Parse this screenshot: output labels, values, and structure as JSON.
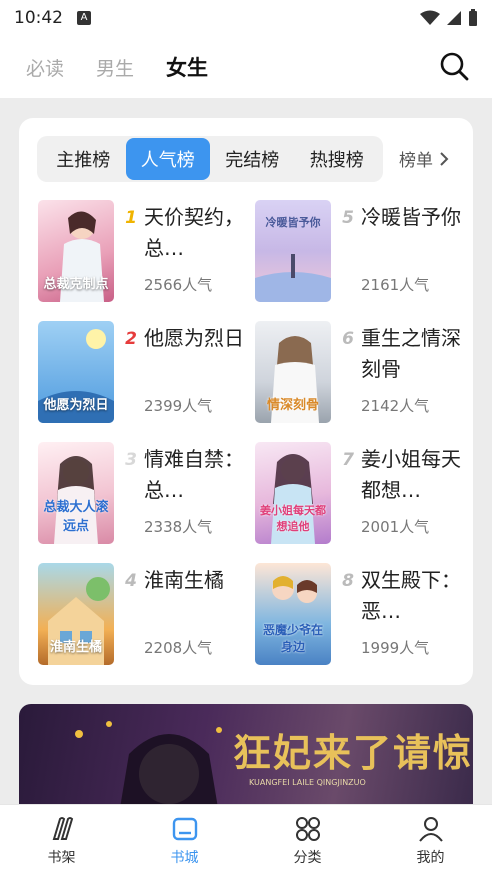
{
  "status": {
    "time": "10:42",
    "badge": "A"
  },
  "top_tabs": [
    {
      "label": "必读"
    },
    {
      "label": "男生"
    },
    {
      "label": "女生",
      "active": true
    }
  ],
  "rank_tabs": [
    {
      "label": "主推榜"
    },
    {
      "label": "人气榜",
      "active": true
    },
    {
      "label": "完结榜"
    },
    {
      "label": "热搜榜"
    }
  ],
  "more_rank_label": "榜单",
  "books": [
    {
      "rank": "1",
      "title": "天价契约，总…",
      "popularity": "2566人气",
      "cover_text": "总裁克制点",
      "cover_color": "#e9a0b8"
    },
    {
      "rank": "2",
      "title": "他愿为烈日",
      "popularity": "2399人气",
      "cover_text": "他愿为烈日",
      "cover_color": "#6fb4e8"
    },
    {
      "rank": "3",
      "title": "情难自禁：总…",
      "popularity": "2338人气",
      "cover_text": "总裁大人滚远点",
      "cover_color": "#f2c4d2"
    },
    {
      "rank": "4",
      "title": "淮南生橘",
      "popularity": "2208人气",
      "cover_text": "淮南生橘",
      "cover_color": "#f2b055"
    },
    {
      "rank": "5",
      "title": "冷暖皆予你",
      "popularity": "2161人气",
      "cover_text": "冷暖皆予你",
      "cover_color": "#c7b8e6"
    },
    {
      "rank": "6",
      "title": "重生之情深刻骨",
      "popularity": "2142人气",
      "cover_text": "情深刻骨",
      "cover_color": "#cfd4dc"
    },
    {
      "rank": "7",
      "title": "姜小姐每天都想…",
      "popularity": "2001人气",
      "cover_text": "姜小姐每天都想追他",
      "cover_color": "#e7b8dc"
    },
    {
      "rank": "8",
      "title": "双生殿下：恶…",
      "popularity": "1999人气",
      "cover_text": "恶魔少爷在身边",
      "cover_color": "#7fb6e0"
    }
  ],
  "banner": {
    "title": "狂妃来了请惊座",
    "subtitle": "KUANGFEI LAILE QINGJINZUO"
  },
  "bottom_nav": [
    {
      "label": "书架"
    },
    {
      "label": "书城",
      "active": true
    },
    {
      "label": "分类"
    },
    {
      "label": "我的"
    }
  ],
  "colors": {
    "accent": "#3d95ef",
    "rank1": "#f0b400",
    "rank2": "#e63c3c"
  }
}
